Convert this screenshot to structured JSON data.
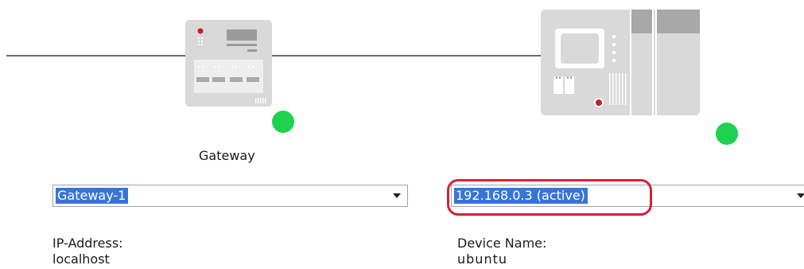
{
  "gateway": {
    "label": "Gateway",
    "selected": "Gateway-1",
    "status_color": "#1ed14f",
    "address_label": "IP-Address:",
    "address_value": "localhost"
  },
  "device": {
    "selected": "192.168.0.3 (active)",
    "status_color": "#1ed14f",
    "name_label": "Device Name:",
    "name_value": "ubuntu"
  },
  "icons": {
    "gateway": "gateway-device-icon",
    "device": "controller-device-icon",
    "dropdown": "chevron-down-icon"
  },
  "colors": {
    "selection": "#3874d8",
    "highlight": "#d4203a",
    "device_gray": "#d9d9d9"
  }
}
